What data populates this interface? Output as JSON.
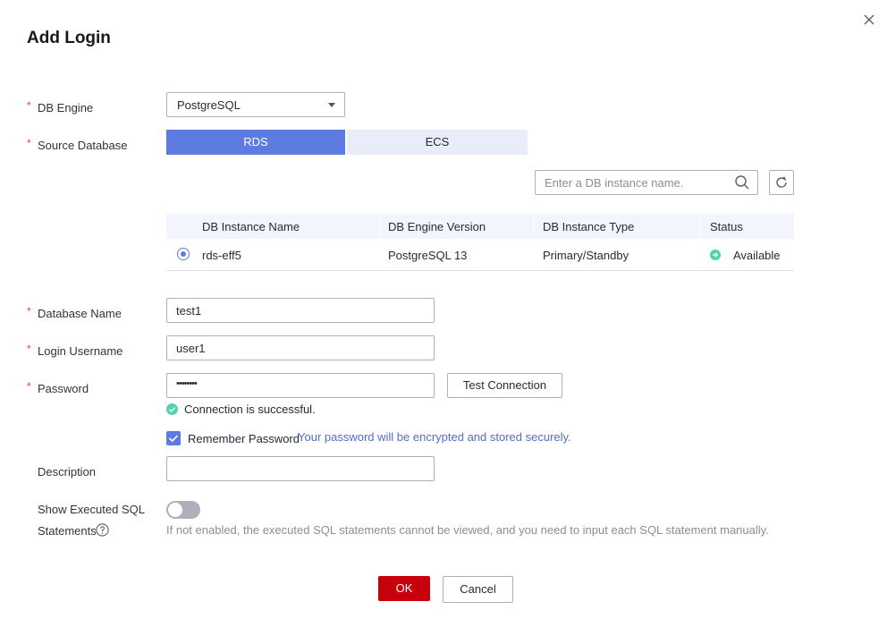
{
  "dialog": {
    "title": "Add Login"
  },
  "form": {
    "db_engine": {
      "label": "DB Engine",
      "value": "PostgreSQL"
    },
    "source_database": {
      "label": "Source Database",
      "options": [
        "RDS",
        "ECS"
      ],
      "selected": "RDS"
    },
    "search": {
      "placeholder": "Enter a DB instance name."
    },
    "table": {
      "columns": [
        "DB Instance Name",
        "DB Engine Version",
        "DB Instance Type",
        "Status"
      ],
      "rows": [
        {
          "name": "rds-eff5",
          "version": "PostgreSQL 13",
          "type": "Primary/Standby",
          "status": "Available",
          "selected": true
        }
      ]
    },
    "database_name": {
      "label": "Database Name",
      "value": "test1"
    },
    "login_username": {
      "label": "Login Username",
      "value": "user1"
    },
    "password": {
      "label": "Password",
      "value": "••••••••"
    },
    "test_connection_label": "Test Connection",
    "connection_status": "Connection is successful.",
    "remember_password": {
      "label": "Remember Password",
      "note": "Your password will be encrypted and stored securely.",
      "checked": true
    },
    "description": {
      "label": "Description",
      "value": ""
    },
    "show_executed_sql": {
      "label_line1": "Show Executed SQL",
      "label_line2": "Statements",
      "enabled": false,
      "hint": "If not enabled, the executed SQL statements cannot be viewed, and you need to input each SQL statement manually."
    }
  },
  "footer": {
    "ok_label": "OK",
    "cancel_label": "Cancel"
  },
  "colors": {
    "primary": "#5e7ce0",
    "danger": "#c7000b",
    "success": "#50d4ab",
    "link": "#526ecc"
  }
}
